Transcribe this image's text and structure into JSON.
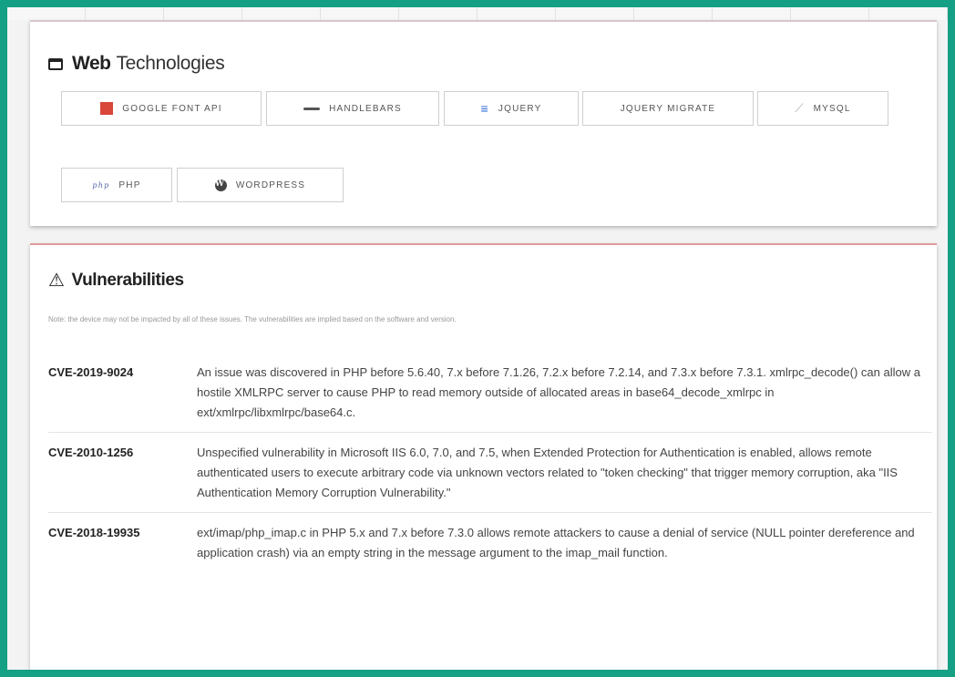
{
  "web_technologies": {
    "title_bold": "Web",
    "title_rest": "Technologies",
    "items": [
      {
        "label": "GOOGLE FONT API",
        "icon": "google-font-icon"
      },
      {
        "label": "HANDLEBARS",
        "icon": "handlebars-icon"
      },
      {
        "label": "JQUERY",
        "icon": "jquery-icon"
      },
      {
        "label": "JQUERY MIGRATE",
        "icon": ""
      },
      {
        "label": "MYSQL",
        "icon": "mysql-icon"
      },
      {
        "label": "PHP",
        "icon": "php-icon"
      },
      {
        "label": "WORDPRESS",
        "icon": "wordpress-icon"
      }
    ]
  },
  "vulnerabilities": {
    "title": "Vulnerabilities",
    "note": "Note: the device may not be impacted by all of these issues. The vulnerabilities are implied based on the software and version.",
    "items": [
      {
        "id": "CVE-2019-9024",
        "description": "An issue was discovered in PHP before 5.6.40, 7.x before 7.1.26, 7.2.x before 7.2.14, and 7.3.x before 7.3.1. xmlrpc_decode() can allow a hostile XMLRPC server to cause PHP to read memory outside of allocated areas in base64_decode_xmlrpc in ext/xmlrpc/libxmlrpc/base64.c."
      },
      {
        "id": "CVE-2010-1256",
        "description": "Unspecified vulnerability in Microsoft IIS 6.0, 7.0, and 7.5, when Extended Protection for Authentication is enabled, allows remote authenticated users to execute arbitrary code via unknown vectors related to \"token checking\" that trigger memory corruption, aka \"IIS Authentication Memory Corruption Vulnerability.\""
      },
      {
        "id": "CVE-2018-19935",
        "description": "ext/imap/php_imap.c in PHP 5.x and 7.x before 7.3.0 allows remote attackers to cause a denial of service (NULL pointer dereference and application crash) via an empty string in the message argument to the imap_mail function."
      }
    ]
  }
}
